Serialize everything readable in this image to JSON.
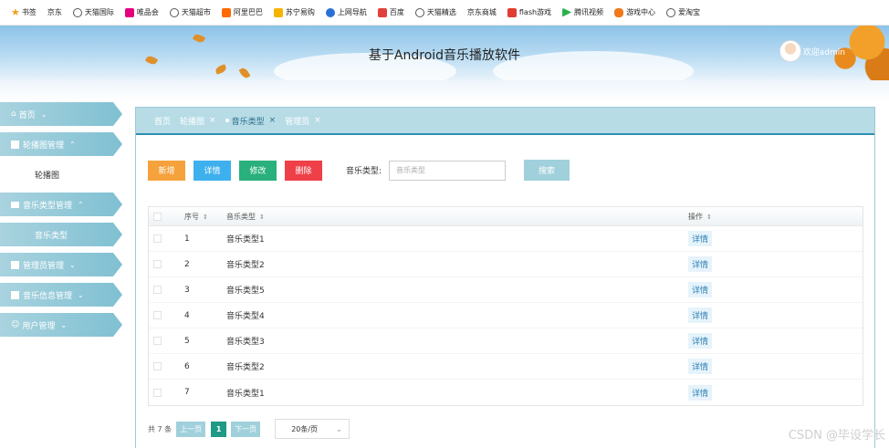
{
  "bookmarks": [
    {
      "label": "书签",
      "icon": "star-icon",
      "color": "#f0a020"
    },
    {
      "label": "京东",
      "icon": "",
      "color": ""
    },
    {
      "label": "天猫国际",
      "icon": "globe-icon",
      "color": "#555555"
    },
    {
      "label": "唯品会",
      "icon": "vip-icon",
      "color": "#e4007f"
    },
    {
      "label": "天猫超市",
      "icon": "globe-icon",
      "color": "#555555"
    },
    {
      "label": "阿里巴巴",
      "icon": "alibaba-icon",
      "color": "#ff6a00"
    },
    {
      "label": "苏宁易购",
      "icon": "suning-icon",
      "color": "#f5b400"
    },
    {
      "label": "上网导航",
      "icon": "nav-icon",
      "color": "#2a6fd6"
    },
    {
      "label": "百度",
      "icon": "baidu-icon",
      "color": "#e0423a"
    },
    {
      "label": "天猫精选",
      "icon": "globe-icon",
      "color": "#555555"
    },
    {
      "label": "京东商城",
      "icon": "",
      "color": ""
    },
    {
      "label": "flash游戏",
      "icon": "flash-icon",
      "color": "#e03c31"
    },
    {
      "label": "腾讯视频",
      "icon": "play-icon",
      "color": "#27b14a"
    },
    {
      "label": "游戏中心",
      "icon": "gamepad-icon",
      "color": "#f07a1a"
    },
    {
      "label": "爱淘宝",
      "icon": "globe-icon",
      "color": "#555555"
    }
  ],
  "header": {
    "title": "基于Android音乐播放软件",
    "welcome": "欢迎admin"
  },
  "sidebar": {
    "items": [
      {
        "label": "首页",
        "icon": "home-icon"
      },
      {
        "label": "轮播图管理",
        "icon": "grid-icon",
        "children": [
          "轮播图"
        ]
      },
      {
        "label": "音乐类型管理",
        "icon": "list-icon",
        "children": [
          "音乐类型"
        ]
      },
      {
        "label": "管理员管理",
        "icon": "grid-icon"
      },
      {
        "label": "音乐信息管理",
        "icon": "apps-icon"
      },
      {
        "label": "用户管理",
        "icon": "user-icon"
      }
    ]
  },
  "tabs": [
    {
      "label": "首页",
      "closable": false
    },
    {
      "label": "轮播图",
      "closable": true
    },
    {
      "label": "音乐类型",
      "closable": true,
      "active": true
    },
    {
      "label": "管理员",
      "closable": true
    }
  ],
  "toolbar": {
    "add": "新增",
    "detail": "详情",
    "edit": "修改",
    "delete": "删除",
    "filter_label": "音乐类型:",
    "filter_placeholder": "音乐类型",
    "search": "搜索"
  },
  "table": {
    "headers": {
      "no": "序号",
      "type": "音乐类型",
      "op": "操作"
    },
    "rows": [
      {
        "no": "1",
        "type": "音乐类型1",
        "op": "详情"
      },
      {
        "no": "2",
        "type": "音乐类型2",
        "op": "详情"
      },
      {
        "no": "3",
        "type": "音乐类型5",
        "op": "详情"
      },
      {
        "no": "4",
        "type": "音乐类型4",
        "op": "详情"
      },
      {
        "no": "5",
        "type": "音乐类型3",
        "op": "详情"
      },
      {
        "no": "6",
        "type": "音乐类型2",
        "op": "详情"
      },
      {
        "no": "7",
        "type": "音乐类型1",
        "op": "详情"
      }
    ]
  },
  "pager": {
    "total": "共 7 条",
    "prev": "上一页",
    "page": "1",
    "next": "下一页",
    "size": "20条/页"
  },
  "watermark": "CSDN @毕设学长"
}
